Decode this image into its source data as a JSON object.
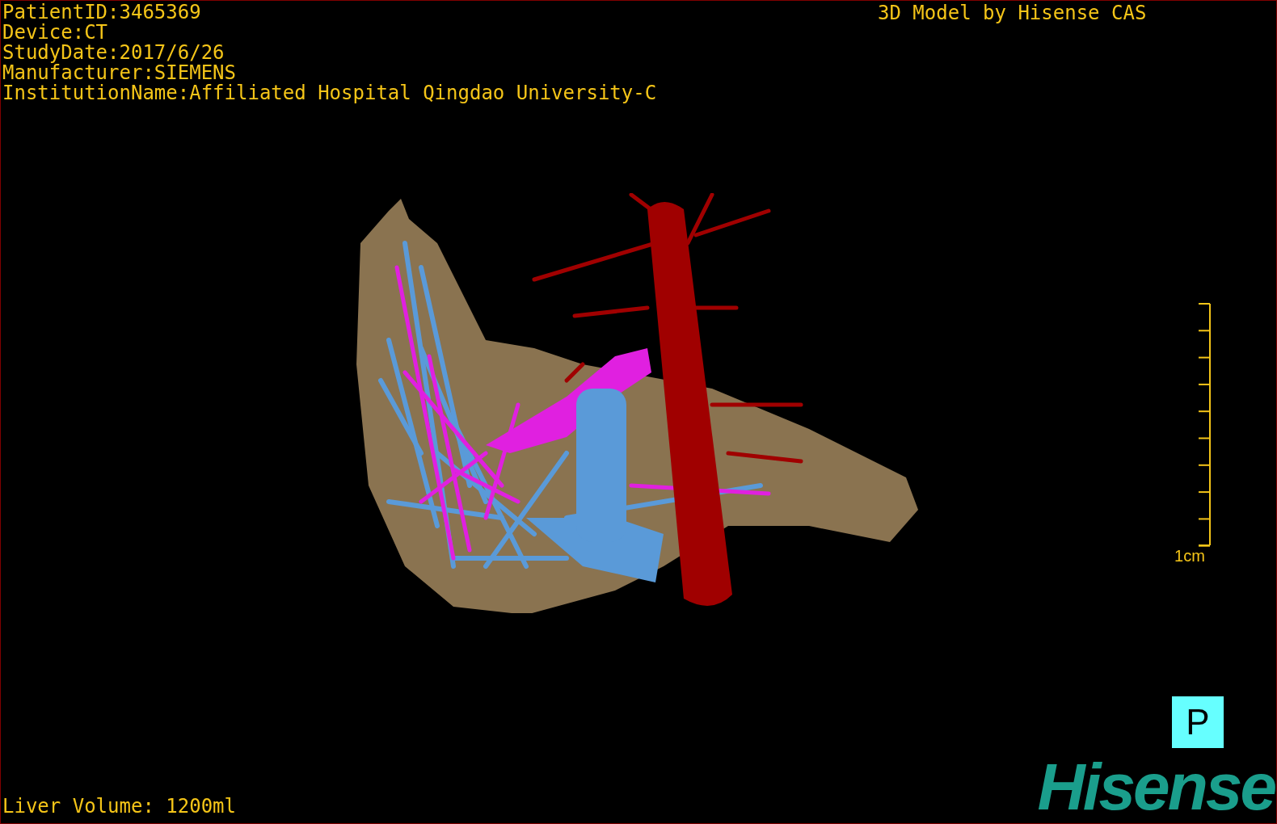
{
  "patient_info": [
    "PatientID:3465369",
    "Device:CT",
    "StudyDate:2017/6/26",
    "Manufacturer:SIEMENS",
    "InstitutionName:Affiliated Hospital Qingdao University-C"
  ],
  "title": "3D Model by Hisense CAS",
  "scale_bar": {
    "label": "1cm"
  },
  "orientation": "P",
  "liver_volume": "Liver Volume: 1200ml",
  "logo": "Hisense"
}
